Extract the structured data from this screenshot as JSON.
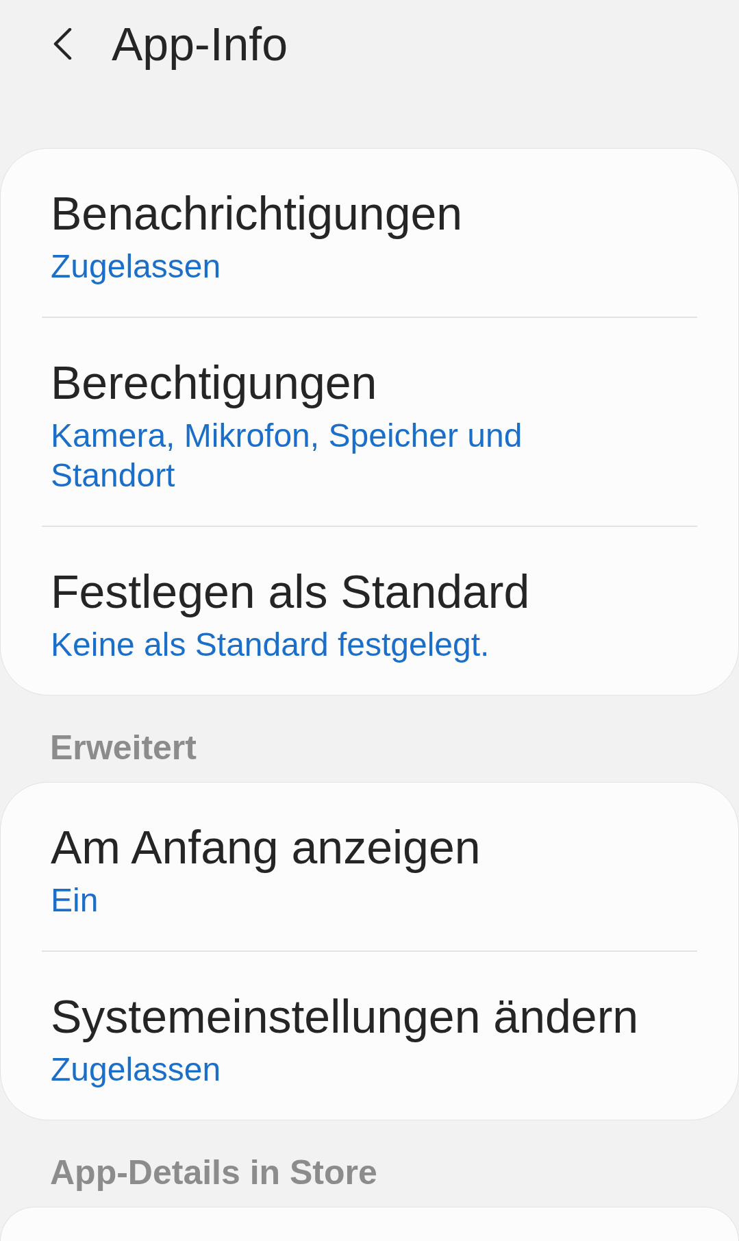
{
  "app_bar": {
    "title": "App-Info"
  },
  "sections": [
    {
      "items": [
        {
          "title": "Benachrichtigungen",
          "value": "Zugelassen"
        },
        {
          "title": "Berechtigungen",
          "value": "Kamera, Mikrofon, Speicher und Standort"
        },
        {
          "title": "Festlegen als Standard",
          "value": "Keine als Standard festgelegt."
        }
      ]
    },
    {
      "header": "Erweitert",
      "items": [
        {
          "title": "Am Anfang anzeigen",
          "value": "Ein"
        },
        {
          "title": "Systemeinstellungen ändern",
          "value": "Zugelassen"
        }
      ]
    },
    {
      "header": "App-Details in Store"
    }
  ]
}
